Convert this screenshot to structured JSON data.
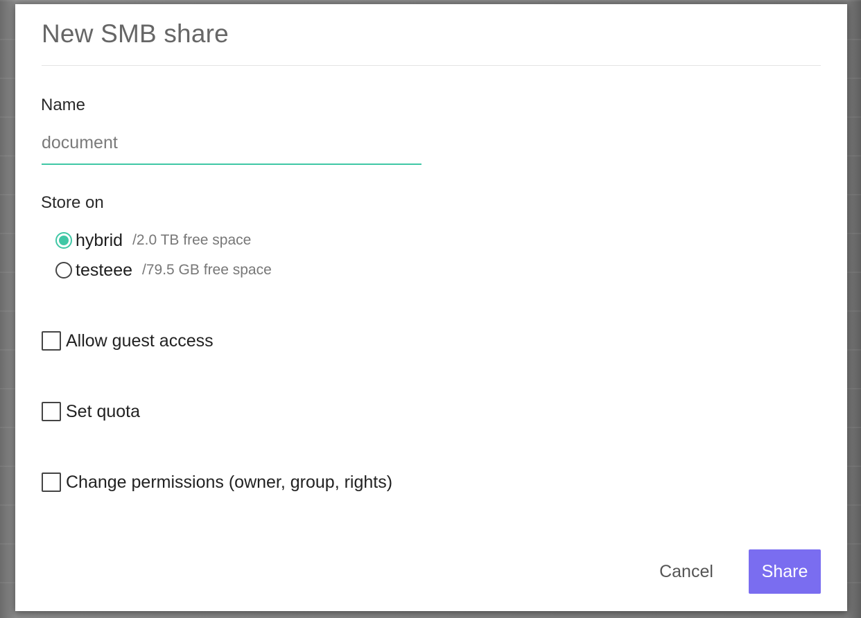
{
  "dialog": {
    "title": "New SMB share"
  },
  "name_field": {
    "label": "Name",
    "value": "document",
    "accent_color": "#3fc7a5"
  },
  "store_on": {
    "label": "Store on",
    "options": [
      {
        "name": "hybrid",
        "free": "/2.0 TB free space",
        "selected": true
      },
      {
        "name": "testeee",
        "free": "/79.5 GB free space",
        "selected": false
      }
    ]
  },
  "options": {
    "guest_access": {
      "label": "Allow guest access",
      "checked": false
    },
    "set_quota": {
      "label": "Set quota",
      "checked": false
    },
    "change_permissions": {
      "label": "Change permissions (owner, group, rights)",
      "checked": false
    }
  },
  "actions": {
    "cancel_label": "Cancel",
    "share_label": "Share",
    "primary_color": "#7a6df0"
  }
}
